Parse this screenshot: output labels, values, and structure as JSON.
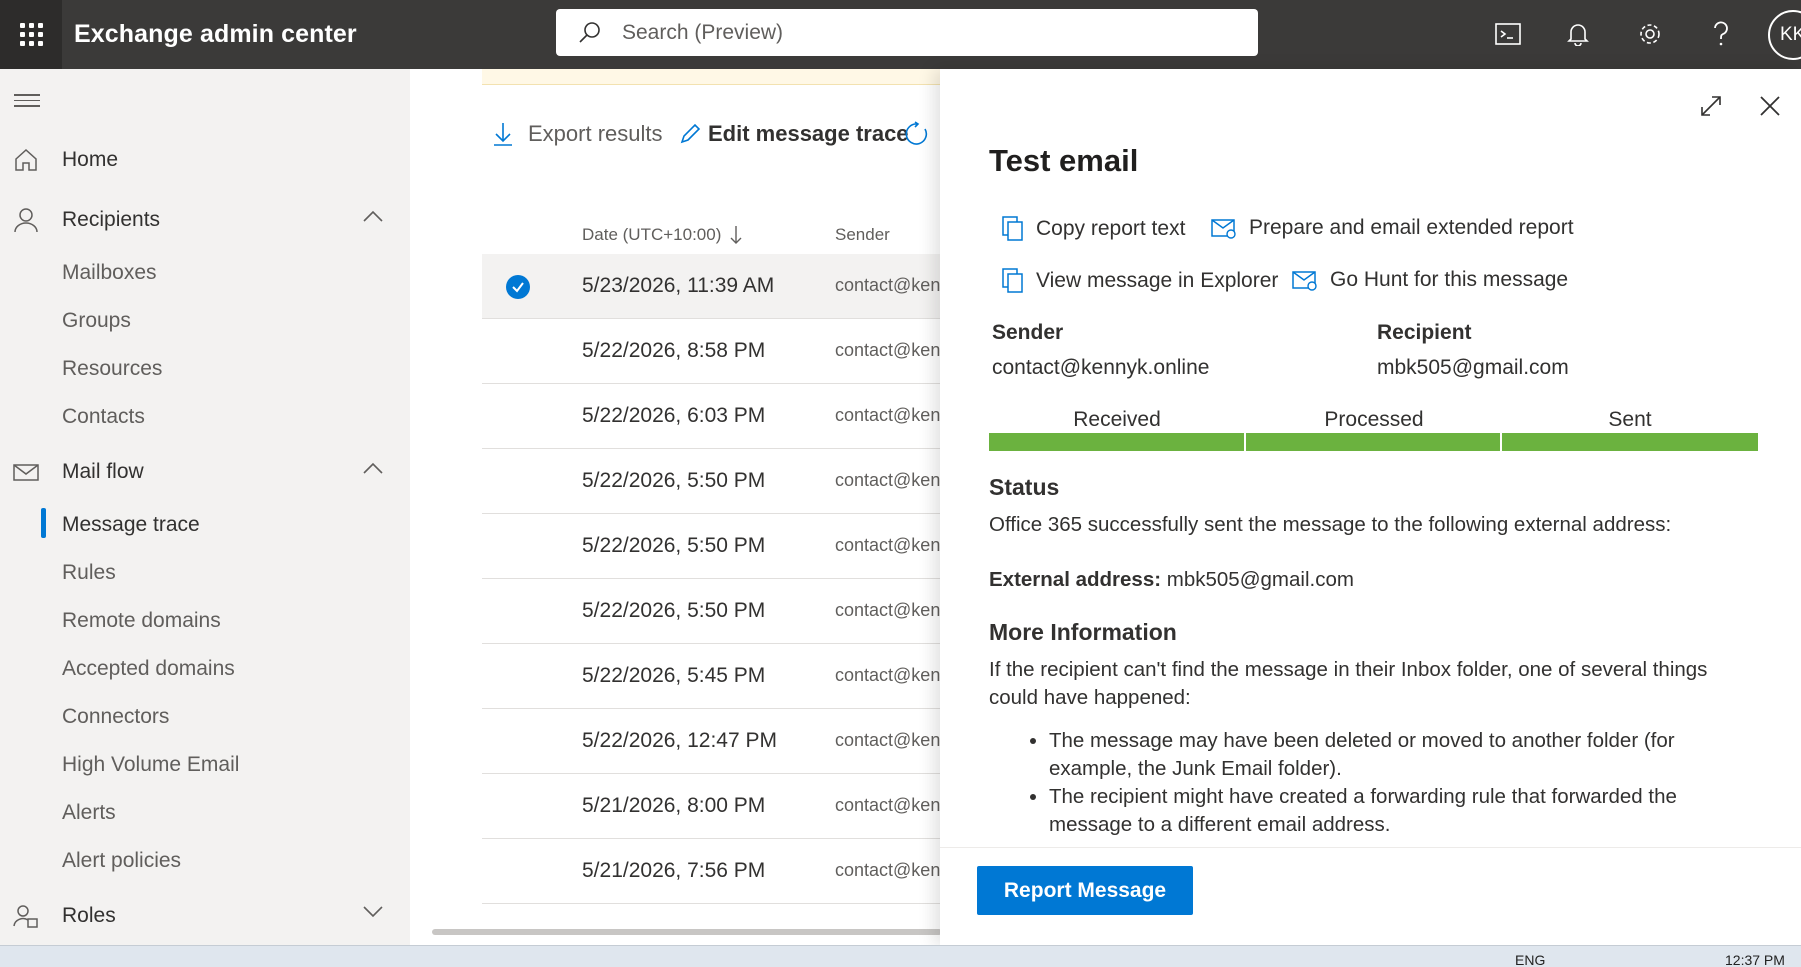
{
  "app": {
    "title": "Exchange admin center"
  },
  "search": {
    "placeholder": "Search (Preview)"
  },
  "user": {
    "initials": "KK"
  },
  "nav": {
    "home": "Home",
    "recipients": "Recipients",
    "recipients_items": [
      "Mailboxes",
      "Groups",
      "Resources",
      "Contacts"
    ],
    "mailflow": "Mail flow",
    "mailflow_items": [
      "Message trace",
      "Rules",
      "Remote domains",
      "Accepted domains",
      "Connectors",
      "High Volume Email",
      "Alerts",
      "Alert policies"
    ],
    "roles": "Roles"
  },
  "toolbar": {
    "export": "Export results",
    "edit": "Edit message trace"
  },
  "list": {
    "col_date": "Date (UTC+10:00)",
    "col_sender": "Sender",
    "rows": [
      {
        "date": "5/23/2026, 11:39 AM",
        "sender": "contact@kennyk.online"
      },
      {
        "date": "5/22/2026, 8:58 PM",
        "sender": "contact@kennyk.online"
      },
      {
        "date": "5/22/2026, 6:03 PM",
        "sender": "contact@kennyk.online"
      },
      {
        "date": "5/22/2026, 5:50 PM",
        "sender": "contact@kennyk.online"
      },
      {
        "date": "5/22/2026, 5:50 PM",
        "sender": "contact@kennyk.online"
      },
      {
        "date": "5/22/2026, 5:50 PM",
        "sender": "contact@kennyk.online"
      },
      {
        "date": "5/22/2026, 5:45 PM",
        "sender": "contact@kennyk.online"
      },
      {
        "date": "5/22/2026, 12:47 PM",
        "sender": "contact@kennyk.online"
      },
      {
        "date": "5/21/2026, 8:00 PM",
        "sender": "contact@kennyk.online"
      },
      {
        "date": "5/21/2026, 7:56 PM",
        "sender": "contact@kennyk.online"
      }
    ]
  },
  "panel": {
    "title": "Test email",
    "actions": {
      "copy": "Copy report text",
      "prepare": "Prepare and email extended report",
      "explorer": "View message in Explorer",
      "hunt": "Go Hunt for this message"
    },
    "sender_label": "Sender",
    "sender_value": "contact@kennyk.online",
    "recipient_label": "Recipient",
    "recipient_value": "mbk505@gmail.com",
    "stages": [
      "Received",
      "Processed",
      "Sent"
    ],
    "status_title": "Status",
    "status_text": "Office 365 successfully sent the message to the following external address:",
    "external_label": "External address:",
    "external_value": "mbk505@gmail.com",
    "more_title": "More Information",
    "more_text": "If the recipient can't find the message in their Inbox folder, one of several things could have happened:",
    "bullets": [
      "The message may have been deleted or moved to another folder (for example, the Junk Email folder).",
      "The recipient might have created a forwarding rule that forwarded the message to a different email address."
    ],
    "report_button": "Report Message"
  },
  "colors": {
    "accent": "#0078d4",
    "topbar": "#3b3a39",
    "progress": "#6bb23f"
  },
  "taskbar": {
    "lang": "ENG",
    "time": "12:37 PM"
  }
}
